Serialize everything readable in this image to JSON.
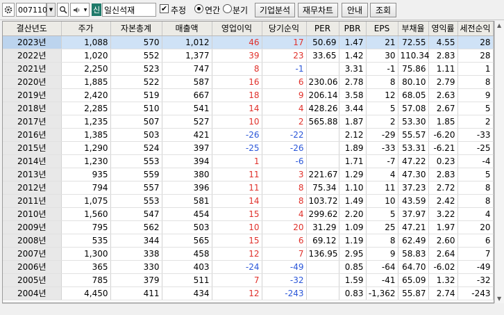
{
  "toolbar": {
    "code": "007110",
    "company": "일신석재",
    "market_badge": "신",
    "estimate_label": "추정",
    "annual_label": "연간",
    "quarter_label": "분기",
    "company_analysis_label": "기업분석",
    "financial_chart_label": "재무차트",
    "guide_label": "안내",
    "query_label": "조회",
    "estimate_checked": true,
    "annual_selected": true
  },
  "table": {
    "columns": [
      "결산년도",
      "주가",
      "자본총계",
      "매출액",
      "영업이익",
      "당기순익",
      "PER",
      "PBR",
      "EPS",
      "부채율",
      "영익률",
      "세전순익"
    ],
    "rows": [
      [
        "2023년",
        "1,088",
        "570",
        "1,012",
        "46",
        "17",
        "50.69",
        "1.47",
        "21",
        "72.55",
        "4.55",
        "28"
      ],
      [
        "2022년",
        "1,020",
        "552",
        "1,377",
        "39",
        "23",
        "33.65",
        "1.42",
        "30",
        "110.34",
        "2.83",
        "28"
      ],
      [
        "2021년",
        "2,250",
        "523",
        "747",
        "8",
        "-1",
        "",
        "3.31",
        "-1",
        "75.86",
        "1.11",
        "1"
      ],
      [
        "2020년",
        "1,885",
        "522",
        "587",
        "16",
        "6",
        "230.06",
        "2.78",
        "8",
        "80.10",
        "2.79",
        "8"
      ],
      [
        "2019년",
        "2,420",
        "519",
        "667",
        "18",
        "9",
        "206.14",
        "3.58",
        "12",
        "68.05",
        "2.63",
        "9"
      ],
      [
        "2018년",
        "2,285",
        "510",
        "541",
        "14",
        "4",
        "428.26",
        "3.44",
        "5",
        "57.08",
        "2.67",
        "5"
      ],
      [
        "2017년",
        "1,235",
        "507",
        "527",
        "10",
        "2",
        "565.88",
        "1.87",
        "2",
        "53.30",
        "1.85",
        "2"
      ],
      [
        "2016년",
        "1,385",
        "503",
        "421",
        "-26",
        "-22",
        "",
        "2.12",
        "-29",
        "55.57",
        "-6.20",
        "-33"
      ],
      [
        "2015년",
        "1,290",
        "524",
        "397",
        "-25",
        "-26",
        "",
        "1.89",
        "-33",
        "53.31",
        "-6.21",
        "-25"
      ],
      [
        "2014년",
        "1,230",
        "553",
        "394",
        "1",
        "-6",
        "",
        "1.71",
        "-7",
        "47.22",
        "0.23",
        "-4"
      ],
      [
        "2013년",
        "935",
        "559",
        "380",
        "11",
        "3",
        "221.67",
        "1.29",
        "4",
        "47.30",
        "2.83",
        "5"
      ],
      [
        "2012년",
        "794",
        "557",
        "396",
        "11",
        "8",
        "75.34",
        "1.10",
        "11",
        "37.23",
        "2.72",
        "8"
      ],
      [
        "2011년",
        "1,075",
        "553",
        "581",
        "14",
        "8",
        "103.72",
        "1.49",
        "10",
        "43.59",
        "2.42",
        "8"
      ],
      [
        "2010년",
        "1,560",
        "547",
        "454",
        "15",
        "4",
        "299.62",
        "2.20",
        "5",
        "37.97",
        "3.22",
        "4"
      ],
      [
        "2009년",
        "795",
        "562",
        "503",
        "10",
        "20",
        "31.29",
        "1.09",
        "25",
        "47.21",
        "1.97",
        "20"
      ],
      [
        "2008년",
        "535",
        "344",
        "565",
        "15",
        "6",
        "69.12",
        "1.19",
        "8",
        "62.49",
        "2.60",
        "6"
      ],
      [
        "2007년",
        "1,300",
        "338",
        "458",
        "12",
        "7",
        "136.95",
        "2.95",
        "9",
        "58.83",
        "2.64",
        "7"
      ],
      [
        "2006년",
        "365",
        "330",
        "403",
        "-24",
        "-49",
        "",
        "0.85",
        "-64",
        "64.70",
        "-6.02",
        "-49"
      ],
      [
        "2005년",
        "785",
        "379",
        "511",
        "7",
        "-32",
        "",
        "1.59",
        "-41",
        "65.09",
        "1.32",
        "-32"
      ],
      [
        "2004년",
        "4,450",
        "411",
        "434",
        "12",
        "-243",
        "",
        "0.83",
        "-1,362",
        "55.87",
        "2.74",
        "-243"
      ]
    ]
  },
  "colors": {
    "positive": "#e0302a",
    "negative": "#2a56d8",
    "selected_row": "#cfe2f6",
    "header": "#ecebe6"
  },
  "icons": [
    "gear-icon",
    "dropdown-arrow-icon",
    "search-icon",
    "speaker-icon"
  ]
}
